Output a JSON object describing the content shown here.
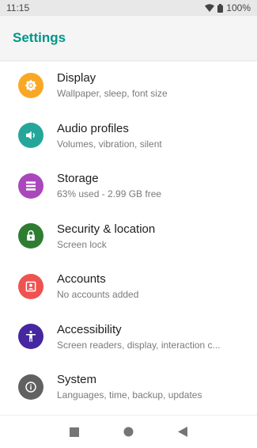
{
  "status_bar": {
    "time": "11:15",
    "battery": "100%"
  },
  "app_bar": {
    "title": "Settings"
  },
  "colors": {
    "accent": "#009688",
    "display": "#F9A825",
    "audio": "#26A69A",
    "storage": "#AB47BC",
    "security": "#2E7D32",
    "accounts": "#EF5350",
    "accessibility": "#4527A0",
    "system": "#616161"
  },
  "items": [
    {
      "title": "Display",
      "subtitle": "Wallpaper, sleep, font size",
      "icon": "brightness-icon"
    },
    {
      "title": "Audio profiles",
      "subtitle": "Volumes, vibration, silent",
      "icon": "speaker-icon"
    },
    {
      "title": "Storage",
      "subtitle": "63% used - 2.99 GB free",
      "icon": "storage-icon"
    },
    {
      "title": "Security & location",
      "subtitle": "Screen lock",
      "icon": "lock-icon"
    },
    {
      "title": "Accounts",
      "subtitle": "No accounts added",
      "icon": "account-box-icon"
    },
    {
      "title": "Accessibility",
      "subtitle": "Screen readers, display, interaction c...",
      "icon": "accessibility-icon"
    },
    {
      "title": "System",
      "subtitle": "Languages, time, backup, updates",
      "icon": "info-icon"
    }
  ],
  "nav": {
    "recents": "recents-icon",
    "home": "home-icon",
    "back": "back-icon"
  }
}
